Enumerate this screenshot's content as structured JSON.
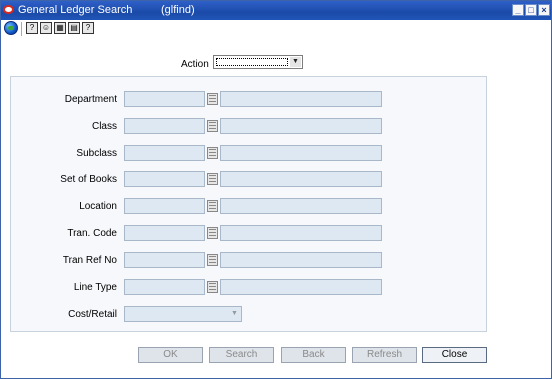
{
  "window": {
    "title": "General Ledger Search",
    "module": "(glfind)",
    "controls": {
      "minimize": "_",
      "maximize": "□",
      "close": "×"
    }
  },
  "toolbar": {
    "icons": [
      "globe-icon",
      "help-icon",
      "users-icon",
      "calendar-icon",
      "save-icon",
      "question-icon"
    ]
  },
  "action": {
    "label": "Action",
    "value": ""
  },
  "fields": [
    {
      "label": "Department"
    },
    {
      "label": "Class"
    },
    {
      "label": "Subclass"
    },
    {
      "label": "Set of Books"
    },
    {
      "label": "Location"
    },
    {
      "label": "Tran. Code"
    },
    {
      "label": "Tran Ref No"
    },
    {
      "label": "Line Type"
    }
  ],
  "cost_retail": {
    "label": "Cost/Retail",
    "value": ""
  },
  "buttons": {
    "ok": "OK",
    "search": "Search",
    "back": "Back",
    "refresh": "Refresh",
    "close": "Close"
  },
  "colors": {
    "titlebar": "#1b4aa8",
    "field_bg": "#dde8f2",
    "group_bg": "#f6f8fb"
  }
}
